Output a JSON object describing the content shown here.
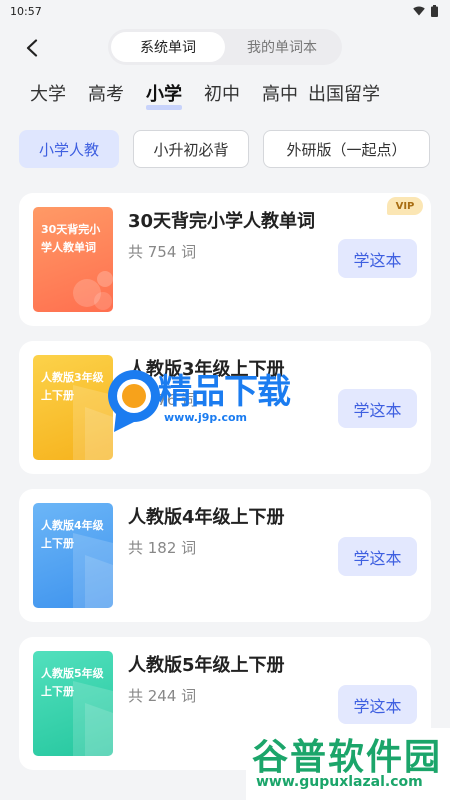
{
  "status": {
    "time": "10:57"
  },
  "tabs": [
    {
      "label": "系统单词"
    },
    {
      "label": "我的单词本"
    }
  ],
  "levels": [
    {
      "label": "大学"
    },
    {
      "label": "高考"
    },
    {
      "label": "小学"
    },
    {
      "label": "初中"
    },
    {
      "label": "高中"
    },
    {
      "label": "出国留学"
    }
  ],
  "editions": [
    {
      "label": "小学人教"
    },
    {
      "label": "小升初必背"
    },
    {
      "label": "外研版（一起点）"
    }
  ],
  "books": [
    {
      "cover": "30天背完小学人教单词",
      "title": "30天背完小学人教单词",
      "count": "共 754 词",
      "badge": "VIP",
      "button": "学这本",
      "color": "#ff8a5b"
    },
    {
      "cover": "人教版3年级上下册",
      "title": "人教版3年级上下册",
      "count": "共 176 词",
      "button": "学这本",
      "color": "#f9c32c"
    },
    {
      "cover": "人教版4年级上下册",
      "title": "人教版4年级上下册",
      "count": "共 182 词",
      "button": "学这本",
      "color": "#56a9f4"
    },
    {
      "cover": "人教版5年级上下册",
      "title": "人教版5年级上下册",
      "count": "共 244 词",
      "button": "学这本",
      "color": "#3ad6b0"
    }
  ],
  "watermark1": {
    "text": "精品下载",
    "url": "www.j9p.com"
  },
  "watermark2": {
    "text": "谷普软件园",
    "url": "www.gupuxlazal.com"
  }
}
